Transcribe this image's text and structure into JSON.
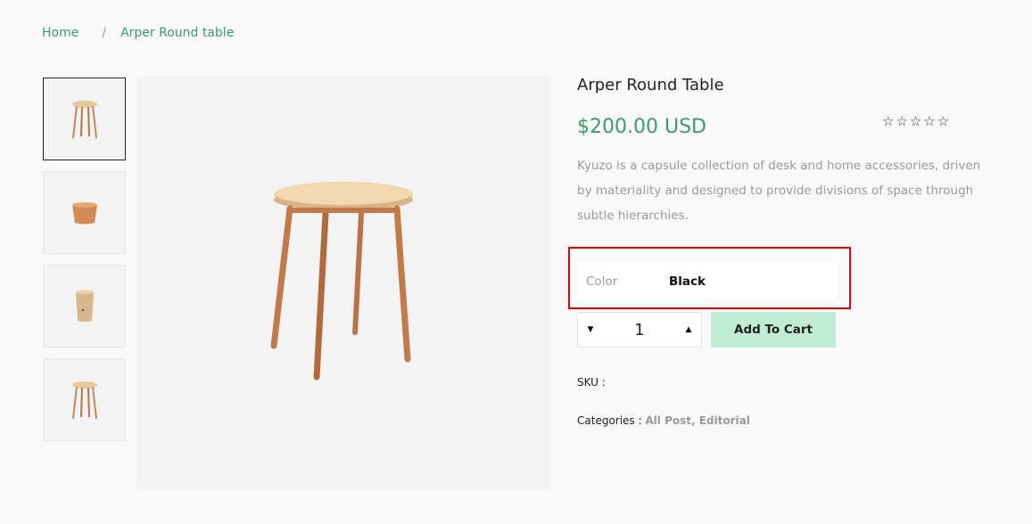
{
  "breadcrumb": {
    "home": "Home",
    "separator": "/",
    "current": "Arper Round table"
  },
  "thumbnails": [
    {
      "icon": "table-thumbnail-icon"
    },
    {
      "icon": "bowl-thumbnail-icon"
    },
    {
      "icon": "cup-thumbnail-icon"
    },
    {
      "icon": "table-thumbnail-icon"
    }
  ],
  "main_image": {
    "icon": "round-stool-table-image"
  },
  "product": {
    "title": "Arper Round Table",
    "price": "$200.00 USD",
    "rating_stars": "☆☆☆☆☆",
    "description": "Kyuzo is a capsule collection of desk and home accessories, driven by materiality and designed to provide divisions of space through subtle hierarchies."
  },
  "variant": {
    "label": "Color",
    "value": "Black"
  },
  "quantity": {
    "value": "1",
    "decrease_icon": "▼",
    "increase_icon": "▲"
  },
  "add_to_cart": "Add To Cart",
  "meta": {
    "sku_label": "SKU :",
    "categories_label": "Categories :",
    "categories": [
      "All Post",
      "Editorial"
    ],
    "category_separator": ", "
  },
  "colors": {
    "accent": "#3d9a6a",
    "button": "#c1ecd6",
    "highlight": "#ee0000"
  }
}
